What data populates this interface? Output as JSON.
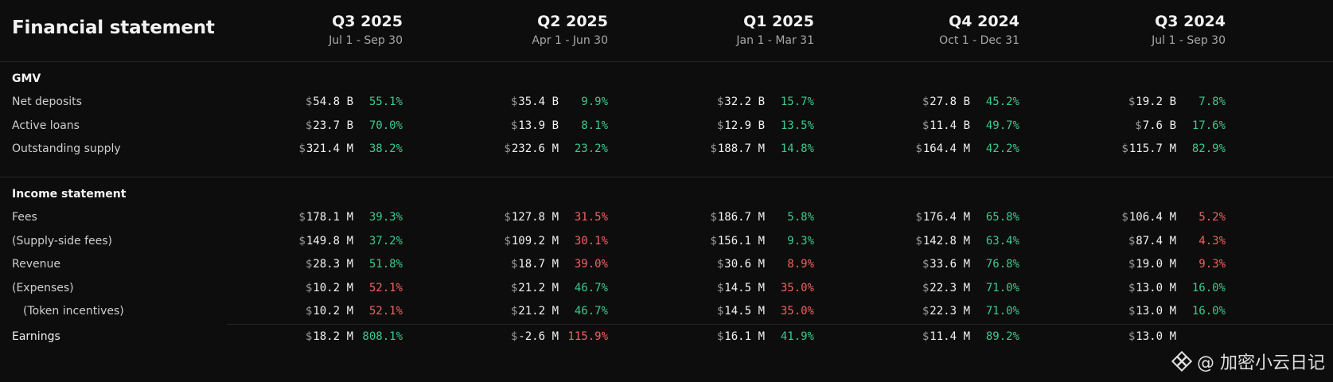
{
  "title": "Financial statement",
  "colors": {
    "positive": "#3ec98e",
    "negative": "#f0625f"
  },
  "quarters": [
    {
      "name": "Q3 2025",
      "range": "Jul 1 - Sep 30"
    },
    {
      "name": "Q2 2025",
      "range": "Apr 1 - Jun 30"
    },
    {
      "name": "Q1 2025",
      "range": "Jan 1 - Mar 31"
    },
    {
      "name": "Q4 2024",
      "range": "Oct 1 - Dec 31"
    },
    {
      "name": "Q3 2024",
      "range": "Jul 1 - Sep 30"
    }
  ],
  "sections": [
    {
      "title": "GMV",
      "rows": [
        {
          "label": "Net deposits",
          "cells": [
            {
              "value": "54.8",
              "unit": "B",
              "pct": "55.1%",
              "trend": "positive"
            },
            {
              "value": "35.4",
              "unit": "B",
              "pct": "9.9%",
              "trend": "positive"
            },
            {
              "value": "32.2",
              "unit": "B",
              "pct": "15.7%",
              "trend": "positive"
            },
            {
              "value": "27.8",
              "unit": "B",
              "pct": "45.2%",
              "trend": "positive"
            },
            {
              "value": "19.2",
              "unit": "B",
              "pct": "7.8%",
              "trend": "positive"
            }
          ]
        },
        {
          "label": "Active loans",
          "cells": [
            {
              "value": "23.7",
              "unit": "B",
              "pct": "70.0%",
              "trend": "positive"
            },
            {
              "value": "13.9",
              "unit": "B",
              "pct": "8.1%",
              "trend": "positive"
            },
            {
              "value": "12.9",
              "unit": "B",
              "pct": "13.5%",
              "trend": "positive"
            },
            {
              "value": "11.4",
              "unit": "B",
              "pct": "49.7%",
              "trend": "positive"
            },
            {
              "value": "7.6",
              "unit": "B",
              "pct": "17.6%",
              "trend": "positive"
            }
          ]
        },
        {
          "label": "Outstanding supply",
          "cells": [
            {
              "value": "321.4",
              "unit": "M",
              "pct": "38.2%",
              "trend": "positive"
            },
            {
              "value": "232.6",
              "unit": "M",
              "pct": "23.2%",
              "trend": "positive"
            },
            {
              "value": "188.7",
              "unit": "M",
              "pct": "14.8%",
              "trend": "positive"
            },
            {
              "value": "164.4",
              "unit": "M",
              "pct": "42.2%",
              "trend": "positive"
            },
            {
              "value": "115.7",
              "unit": "M",
              "pct": "82.9%",
              "trend": "positive"
            }
          ]
        }
      ]
    },
    {
      "title": "Income statement",
      "rows": [
        {
          "label": "Fees",
          "cells": [
            {
              "value": "178.1",
              "unit": "M",
              "pct": "39.3%",
              "trend": "positive"
            },
            {
              "value": "127.8",
              "unit": "M",
              "pct": "31.5%",
              "trend": "negative"
            },
            {
              "value": "186.7",
              "unit": "M",
              "pct": "5.8%",
              "trend": "positive"
            },
            {
              "value": "176.4",
              "unit": "M",
              "pct": "65.8%",
              "trend": "positive"
            },
            {
              "value": "106.4",
              "unit": "M",
              "pct": "5.2%",
              "trend": "negative"
            }
          ]
        },
        {
          "label": "(Supply-side fees)",
          "cells": [
            {
              "value": "149.8",
              "unit": "M",
              "pct": "37.2%",
              "trend": "positive"
            },
            {
              "value": "109.2",
              "unit": "M",
              "pct": "30.1%",
              "trend": "negative"
            },
            {
              "value": "156.1",
              "unit": "M",
              "pct": "9.3%",
              "trend": "positive"
            },
            {
              "value": "142.8",
              "unit": "M",
              "pct": "63.4%",
              "trend": "positive"
            },
            {
              "value": "87.4",
              "unit": "M",
              "pct": "4.3%",
              "trend": "negative"
            }
          ]
        },
        {
          "label": "Revenue",
          "cells": [
            {
              "value": "28.3",
              "unit": "M",
              "pct": "51.8%",
              "trend": "positive"
            },
            {
              "value": "18.7",
              "unit": "M",
              "pct": "39.0%",
              "trend": "negative"
            },
            {
              "value": "30.6",
              "unit": "M",
              "pct": "8.9%",
              "trend": "negative"
            },
            {
              "value": "33.6",
              "unit": "M",
              "pct": "76.8%",
              "trend": "positive"
            },
            {
              "value": "19.0",
              "unit": "M",
              "pct": "9.3%",
              "trend": "negative"
            }
          ]
        },
        {
          "label": "(Expenses)",
          "cells": [
            {
              "value": "10.2",
              "unit": "M",
              "pct": "52.1%",
              "trend": "negative"
            },
            {
              "value": "21.2",
              "unit": "M",
              "pct": "46.7%",
              "trend": "positive"
            },
            {
              "value": "14.5",
              "unit": "M",
              "pct": "35.0%",
              "trend": "negative"
            },
            {
              "value": "22.3",
              "unit": "M",
              "pct": "71.0%",
              "trend": "positive"
            },
            {
              "value": "13.0",
              "unit": "M",
              "pct": "16.0%",
              "trend": "positive"
            }
          ]
        },
        {
          "label": "(Token incentives)",
          "indent": true,
          "cells": [
            {
              "value": "10.2",
              "unit": "M",
              "pct": "52.1%",
              "trend": "negative"
            },
            {
              "value": "21.2",
              "unit": "M",
              "pct": "46.7%",
              "trend": "positive"
            },
            {
              "value": "14.5",
              "unit": "M",
              "pct": "35.0%",
              "trend": "negative"
            },
            {
              "value": "22.3",
              "unit": "M",
              "pct": "71.0%",
              "trend": "positive"
            },
            {
              "value": "13.0",
              "unit": "M",
              "pct": "16.0%",
              "trend": "positive"
            }
          ]
        },
        {
          "label": "Earnings",
          "strong": true,
          "cells": [
            {
              "value": "18.2",
              "unit": "M",
              "pct": "808.1%",
              "trend": "positive"
            },
            {
              "value": "-2.6",
              "unit": "M",
              "pct": "115.9%",
              "trend": "negative"
            },
            {
              "value": "16.1",
              "unit": "M",
              "pct": "41.9%",
              "trend": "positive"
            },
            {
              "value": "11.4",
              "unit": "M",
              "pct": "89.2%",
              "trend": "positive"
            },
            {
              "value": "13.0",
              "unit": "M",
              "pct": "",
              "trend": "positive"
            }
          ]
        }
      ]
    }
  ],
  "currency_symbol": "$",
  "watermark": {
    "text": "@ 加密小云日记",
    "icon": "binance-logo-icon"
  }
}
